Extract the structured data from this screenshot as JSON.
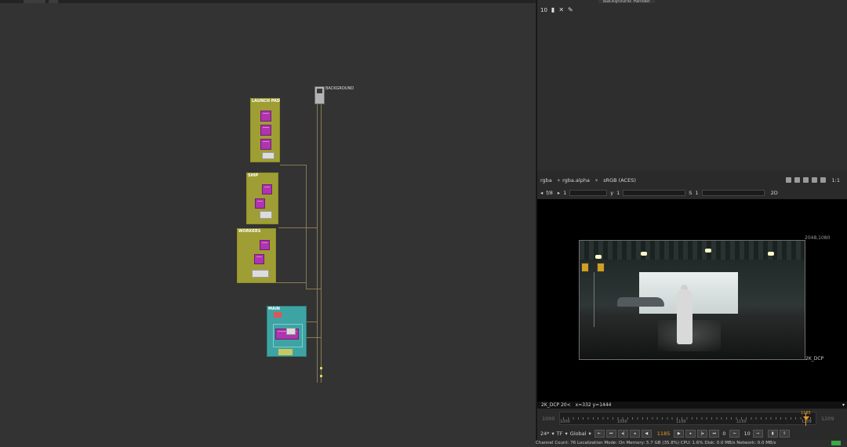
{
  "graph": {
    "backdrops": {
      "launch_pad": "LAUNCH PAD",
      "ship": "SHIP",
      "workers": "WORKERS",
      "main": "MAIN"
    },
    "background_node_label": "BACKGROUND"
  },
  "properties": {
    "tab_label": "Background_Render",
    "max_panels": "10"
  },
  "viewer": {
    "channels": "rgba",
    "alpha_channel": "rgba.alpha",
    "colorspace": "sRGB (ACES)",
    "zoom": "1:1",
    "fstop": "f/8",
    "gain": "1",
    "gamma_label": "y",
    "gamma": "1",
    "saturation_label": "S",
    "saturation": "1",
    "view_mode": "2D",
    "resolution_corner": "2048,1080",
    "format_label": "2K_DCP",
    "info_format": "2K_DCP 20<",
    "info_coords": "x=332 y=1444"
  },
  "timeline": {
    "start_frame": "1000",
    "end_frame": "1209",
    "ticks": [
      "1000",
      "1050",
      "1100",
      "1150",
      "1209"
    ],
    "playhead_frame": "1185",
    "progress": 0.885
  },
  "playback": {
    "fps": "24*",
    "tf": "TF",
    "range_mode": "Global",
    "current_frame": "1185",
    "loop_count": "0",
    "skip_frames": "10"
  },
  "status": {
    "text": "Channel Count: 76  Localization Mode: On  Memory: 5.7 GB (35.8%)  CPU: 1.6%  Disk: 0.0 MB/s  Network: 0.0 MB/s"
  },
  "colors": {
    "accent": "#e69a28",
    "backdrop_yellow": "#9e9e35",
    "backdrop_teal": "#3ea3a3",
    "node_purple": "#b033b0",
    "status_ok": "#3aa843"
  }
}
